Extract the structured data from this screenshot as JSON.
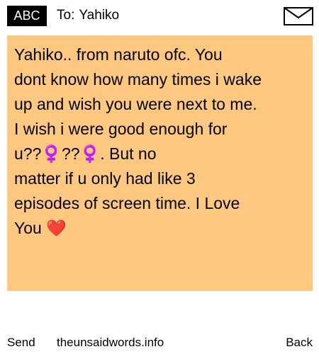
{
  "header": {
    "mode_label": "ABC",
    "to_prefix": "To:",
    "recipient": "Yahiko",
    "icon": "envelope-icon"
  },
  "message": {
    "body": "Yahiko.. from naruto ofc. You\ndont know how many times i wake\nup and wish you were next to me.\nI wish i were good enough for\nu??♀️??♀️. But no\nmatter if u only had like 3\nepisodes of screen time. I Love\nYou ❤️"
  },
  "footer": {
    "send_label": "Send",
    "site_label": "theunsaidwords.info",
    "back_label": "Back"
  },
  "colors": {
    "message_background": "#ffc880",
    "badge_background": "#000000",
    "badge_text": "#ffffff"
  }
}
